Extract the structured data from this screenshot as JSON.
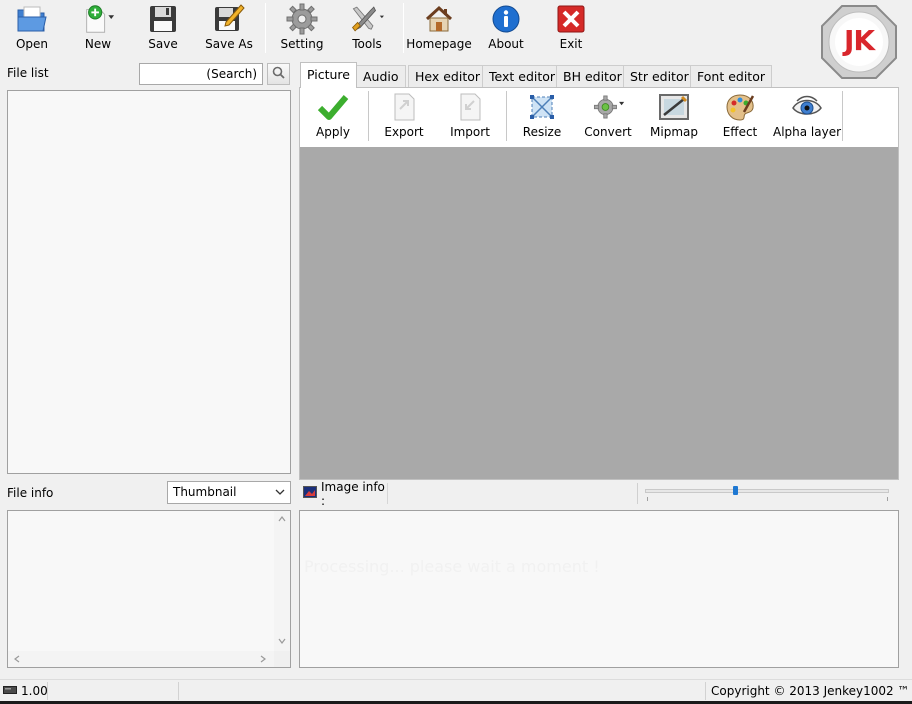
{
  "toolbar": {
    "buttons": [
      {
        "label": "Open",
        "icon": "folder-open-icon"
      },
      {
        "label": "New",
        "icon": "new-file-icon"
      },
      {
        "label": "Save",
        "icon": "floppy-disk-icon"
      },
      {
        "label": "Save As",
        "icon": "floppy-pencil-icon"
      },
      {
        "label": "Setting",
        "icon": "gear-icon"
      },
      {
        "label": "Tools",
        "icon": "wrench-screwdriver-icon"
      },
      {
        "label": "Homepage",
        "icon": "house-icon"
      },
      {
        "label": "About",
        "icon": "info-icon"
      },
      {
        "label": "Exit",
        "icon": "close-x-icon"
      }
    ],
    "logo_text": "JK"
  },
  "left": {
    "file_list_label": "File list",
    "search_placeholder": "(Search)",
    "file_info_label": "File info",
    "view_select_value": "Thumbnail"
  },
  "tabs": [
    {
      "label": "Picture",
      "active": true
    },
    {
      "label": "Audio",
      "active": false
    },
    {
      "label": "Hex editor",
      "active": false
    },
    {
      "label": "Text editor",
      "active": false
    },
    {
      "label": "BH editor",
      "active": false
    },
    {
      "label": "Str editor",
      "active": false
    },
    {
      "label": "Font editor",
      "active": false
    }
  ],
  "picture_toolbar": {
    "buttons": [
      {
        "label": "Apply",
        "icon": "checkmark-icon"
      },
      {
        "label": "Export",
        "icon": "export-page-icon"
      },
      {
        "label": "Import",
        "icon": "import-page-icon"
      },
      {
        "label": "Resize",
        "icon": "resize-frame-icon"
      },
      {
        "label": "Convert",
        "icon": "gear-convert-icon"
      },
      {
        "label": "Mipmap",
        "icon": "mipmap-icon"
      },
      {
        "label": "Effect",
        "icon": "palette-icon"
      },
      {
        "label": "Alpha layer",
        "icon": "eye-icon"
      }
    ]
  },
  "image_info": {
    "label": "Image info :",
    "zoom_level": 0.37
  },
  "output": {
    "processing_text": "Processing... please wait a moment !"
  },
  "status": {
    "version": "1.00",
    "copyright": "Copyright © 2013 Jenkey1002 ™"
  },
  "colors": {
    "canvas": "#a9a9a9",
    "accent_blue": "#1e78d2",
    "logo_red": "#d9262c"
  }
}
